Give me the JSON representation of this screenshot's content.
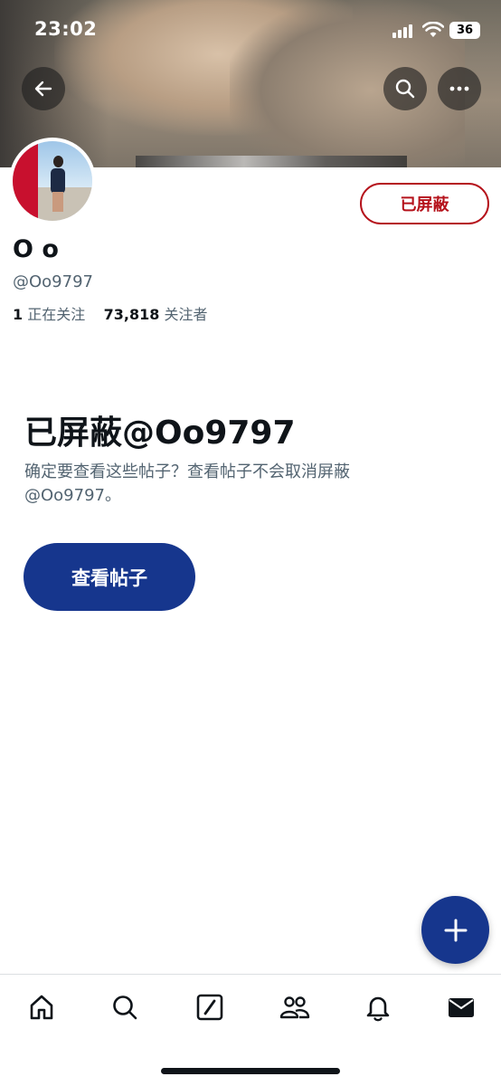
{
  "status_bar": {
    "time": "23:02",
    "battery": "36"
  },
  "profile": {
    "display_name": "O o",
    "handle": "@Oo9797",
    "following_count": "1",
    "following_label": "正在关注",
    "followers_count": "73,818",
    "followers_label": "关注者",
    "blocked_button_label": "已屏蔽"
  },
  "blocked_notice": {
    "title": "已屏蔽@Oo9797",
    "description": "确定要查看这些帖子？查看帖子不会取消屏蔽@Oo9797。",
    "view_posts_label": "查看帖子"
  },
  "icons": {
    "back": "arrow-left-icon",
    "search": "search-icon",
    "more": "more-horizontal-icon",
    "compose": "plus-icon",
    "tabs": [
      "home-icon",
      "search-icon",
      "grok-icon",
      "communities-icon",
      "bell-icon",
      "mail-icon"
    ]
  },
  "colors": {
    "accent": "#16368d",
    "blocked": "#b5121b",
    "muted_text": "#536471"
  }
}
